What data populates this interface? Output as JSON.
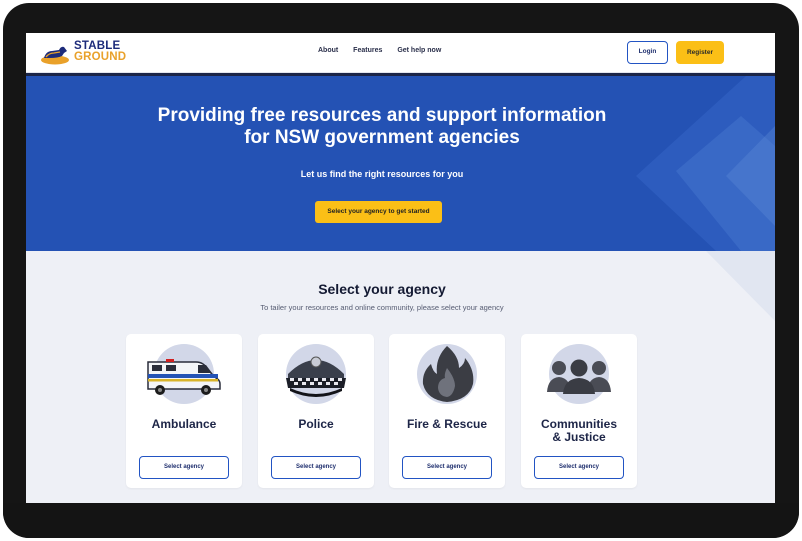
{
  "brand": {
    "line1": "STABLE",
    "line2": "GROUND"
  },
  "nav": {
    "links": [
      "About",
      "Features",
      "Get help now"
    ],
    "login": "Login",
    "register": "Register"
  },
  "hero": {
    "title_line1": "Providing free resources and support information",
    "title_line2": "for NSW government agencies",
    "subtitle": "Let us find the right resources for you",
    "cta": "Select your agency to get started"
  },
  "agency": {
    "title": "Select your agency",
    "subtitle": "To tailer your resources and online community, please select your agency",
    "cards": [
      {
        "name": "Ambulance",
        "button": "Select agency",
        "icon": "ambulance-icon"
      },
      {
        "name": "Police",
        "button": "Select agency",
        "icon": "police-cap-icon"
      },
      {
        "name": "Fire & Rescue",
        "button": "Select agency",
        "icon": "flame-icon"
      },
      {
        "name_line1": "Communities",
        "name_line2": "& Justice",
        "button": "Select agency",
        "icon": "people-icon"
      }
    ]
  },
  "colors": {
    "primary": "#2452b4",
    "accent": "#fbbf16",
    "navy": "#1d2b7a",
    "page_bg": "#eef0f6"
  }
}
